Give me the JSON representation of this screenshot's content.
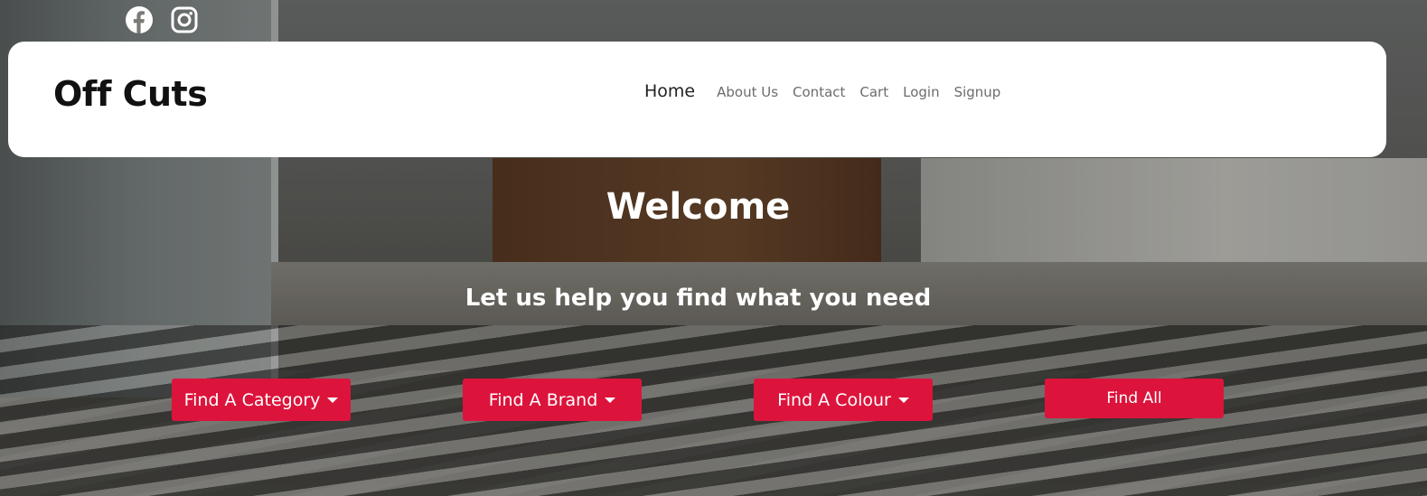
{
  "social": {
    "facebook_icon": "facebook-icon",
    "instagram_icon": "instagram-icon"
  },
  "navbar": {
    "brand": "Off Cuts",
    "links": [
      {
        "label": "Home",
        "active": true
      },
      {
        "label": "About Us"
      },
      {
        "label": "Contact"
      },
      {
        "label": "Cart"
      },
      {
        "label": "Login"
      },
      {
        "label": "Signup"
      }
    ]
  },
  "hero": {
    "title": "Welcome",
    "subtitle": "Let us help you find what you need"
  },
  "buttons": {
    "category": "Find A Category",
    "brand": "Find A Brand",
    "colour": "Find A Colour",
    "all": "Find All"
  },
  "colors": {
    "accent": "#dc143c",
    "navbar_bg": "#ffffff"
  }
}
